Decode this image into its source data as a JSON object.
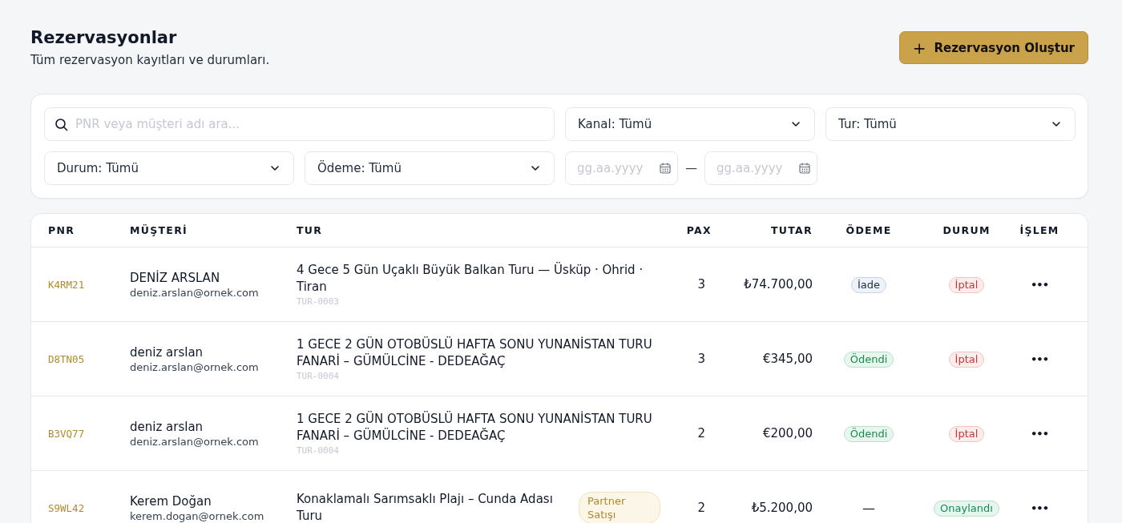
{
  "header": {
    "title": "Rezervasyonlar",
    "subtitle": "Tüm rezervasyon kayıtları ve durumları.",
    "create_button": {
      "icon": "+",
      "label": "Rezervasyon Oluştur"
    }
  },
  "filters": {
    "search": {
      "placeholder": "PNR veya müşteri adı ara..."
    },
    "selects": [
      {
        "label": "Kanal: Tümü"
      },
      {
        "label": "Tur: Tümü"
      },
      {
        "label": "Durum: Tümü"
      },
      {
        "label": "Ödeme: Tümü"
      }
    ],
    "date_from": {
      "placeholder": "gg.aa.yyyy"
    },
    "date_separator": "—",
    "date_to": {
      "placeholder": "gg.aa.yyyy"
    }
  },
  "table": {
    "columns": [
      "PNR",
      "MÜŞTERİ",
      "TUR",
      "PAX",
      "TUTAR",
      "ÖDEME",
      "DURUM",
      "İŞLEM"
    ],
    "rows": [
      {
        "pnr": "K4RM21",
        "customer": "DENİZ ARSLAN",
        "email": "deniz.arslan@ornek.com",
        "tour": "4 Gece 5 Gün Uçaklı Büyük Balkan Turu — Üsküp · Ohrid · Tiran",
        "tour_code": "TUR-0003",
        "pax": "3",
        "amount": "₺74.700,00",
        "payment": {
          "kind": "refund",
          "label": "İade"
        },
        "status": {
          "kind": "cancelled",
          "label": "İptal"
        },
        "action": "•••"
      },
      {
        "pnr": "D8TN05",
        "customer": "deniz arslan",
        "email": "deniz.arslan@ornek.com",
        "tour": "1 GECE 2 GÜN OTOBÜSLÜ HAFTA SONU YUNANİSTAN TURU FANARİ – GÜMÜLCİNE - DEDEAĞAÇ",
        "tour_code": "TUR-0004",
        "pax": "3",
        "amount": "€345,00",
        "payment": {
          "kind": "paid",
          "label": "Ödendi"
        },
        "status": {
          "kind": "cancelled",
          "label": "İptal"
        },
        "action": "•••"
      },
      {
        "pnr": "B3VQ77",
        "customer": "deniz arslan",
        "email": "deniz.arslan@ornek.com",
        "tour": "1 GECE 2 GÜN OTOBÜSLÜ HAFTA SONU YUNANİSTAN TURU FANARİ – GÜMÜLCİNE - DEDEAĞAÇ",
        "tour_code": "TUR-0004",
        "pax": "2",
        "amount": "€200,00",
        "payment": {
          "kind": "paid",
          "label": "Ödendi"
        },
        "status": {
          "kind": "cancelled",
          "label": "İptal"
        },
        "action": "•••"
      },
      {
        "pnr": "S9WL42",
        "customer": "Kerem Doğan",
        "email": "kerem.dogan@ornek.com",
        "tour": "Konaklamalı Sarımsaklı Plajı – Cunda Adası Turu",
        "tag": "Partner Satışı",
        "pax": "2",
        "amount": "₺5.200,00",
        "payment": {
          "kind": "none",
          "label": "—"
        },
        "status": {
          "kind": "confirmed",
          "label": "Onaylandı"
        },
        "action": "•••"
      }
    ]
  }
}
